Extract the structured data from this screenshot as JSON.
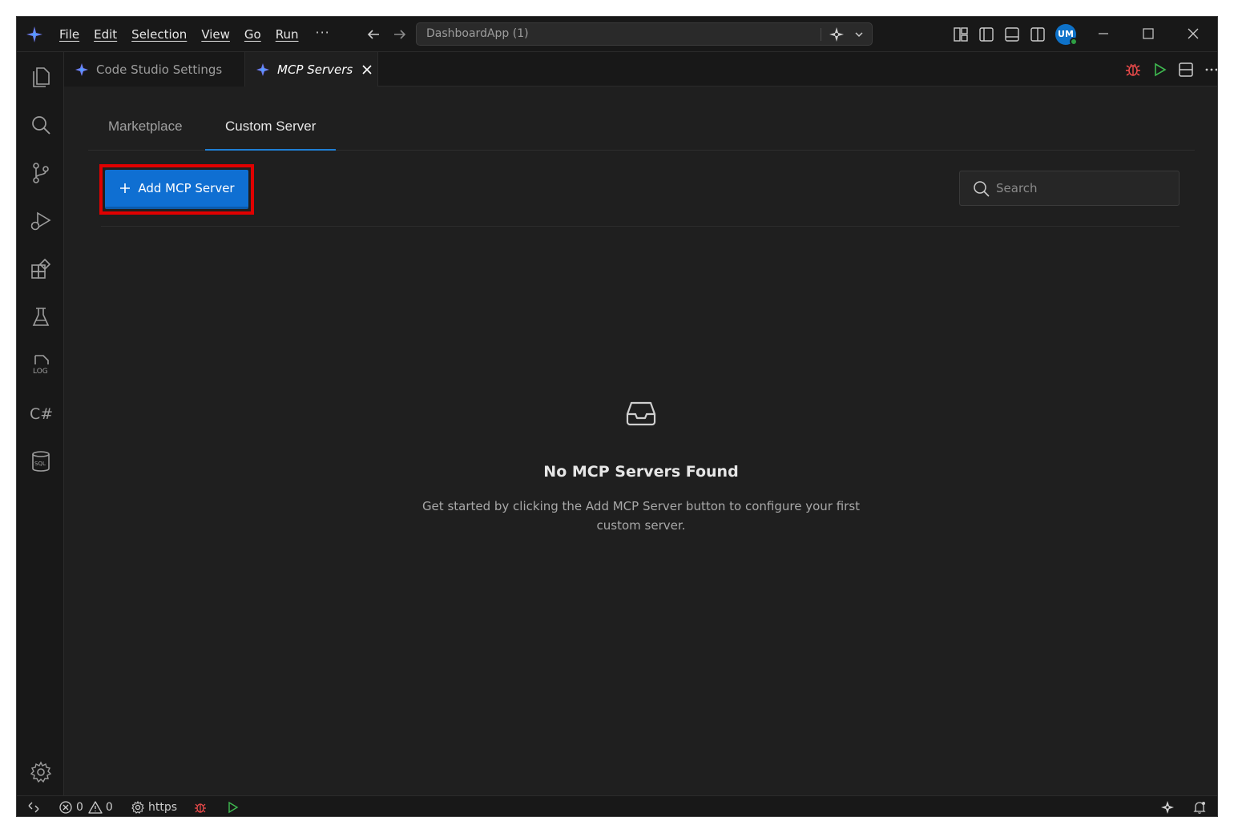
{
  "menu": {
    "items": [
      "File",
      "Edit",
      "Selection",
      "View",
      "Go",
      "Run"
    ],
    "more": "···"
  },
  "command_center": {
    "text": "DashboardApp (1)"
  },
  "account": {
    "initials": "UM"
  },
  "tabs": [
    {
      "label": "Code Studio Settings",
      "active": false
    },
    {
      "label": "MCP Servers",
      "active": true
    }
  ],
  "subtabs": {
    "marketplace": "Marketplace",
    "custom": "Custom Server"
  },
  "toolbar": {
    "add_label": "Add MCP Server",
    "search_placeholder": "Search"
  },
  "empty_state": {
    "title": "No MCP Servers Found",
    "description": "Get started by clicking the Add MCP Server button to configure your first custom server."
  },
  "statusbar": {
    "errors": "0",
    "warnings": "0",
    "profile": "https"
  },
  "colors": {
    "accent": "#0f6fd2",
    "highlight": "#e00000",
    "debug": "#f14c4c",
    "run": "#3fb950",
    "background": "#1f1f1f"
  }
}
